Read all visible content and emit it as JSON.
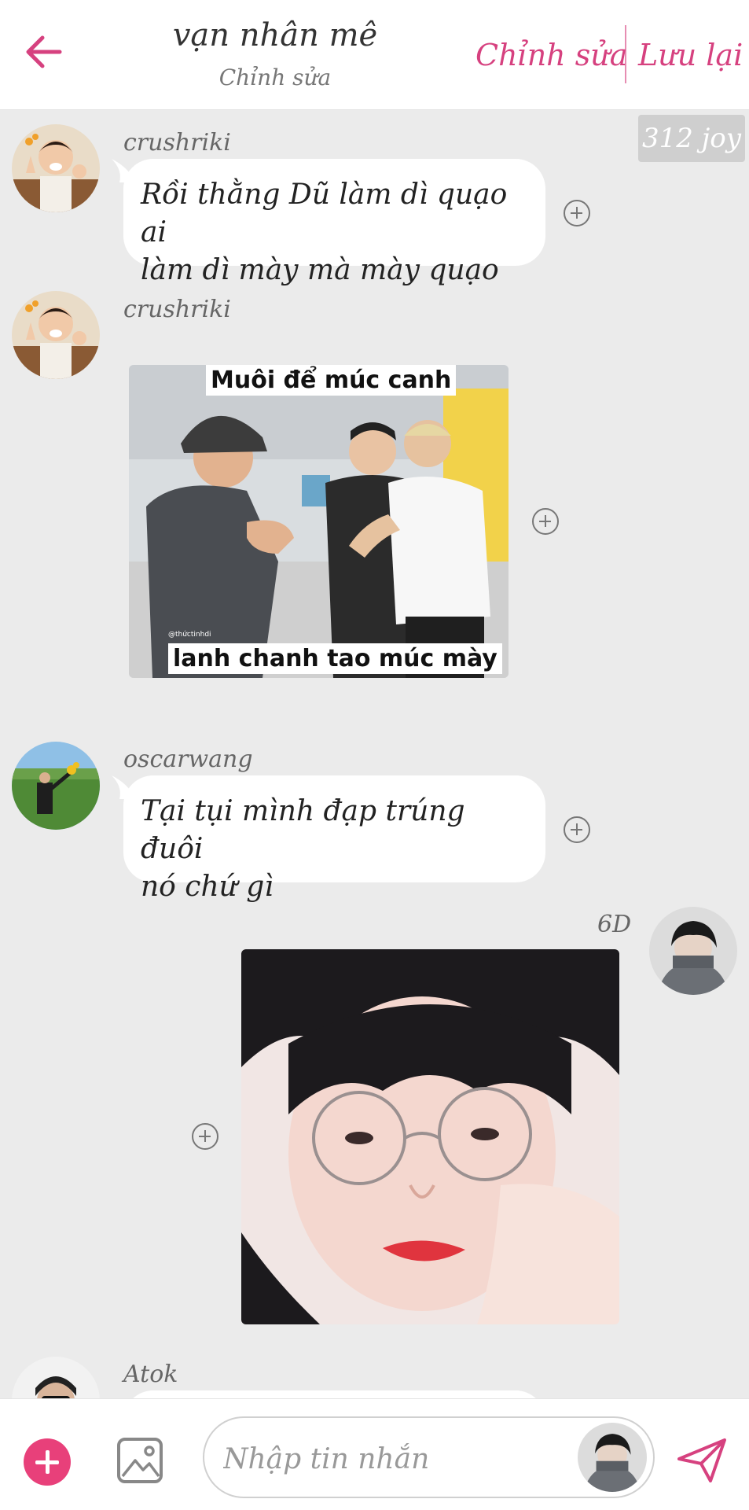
{
  "header": {
    "title": "vạn nhân mê",
    "subtitle": "Chỉnh sửa",
    "edit_label": "Chỉnh sửa",
    "save_label": "Lưu lại"
  },
  "tag_chip": "312 joy",
  "messages": [
    {
      "user": "crushriki",
      "type": "text",
      "text_line1": "Rồi thằng Dũ làm dì quạo ai",
      "text_line2": "làm dì mày mà mày quạo"
    },
    {
      "user": "crushriki",
      "type": "image",
      "caption_top": "Muôi để múc canh",
      "caption_bottom": "lanh chanh tao múc mày",
      "watermark": "@thứctinhdi"
    },
    {
      "user": "oscarwang",
      "type": "text",
      "text_line1": "Tại tụi mình đạp trúng đuôi",
      "text_line2": "nó chứ gì"
    },
    {
      "user": "6D",
      "type": "image"
    },
    {
      "user": "Atok",
      "type": "text"
    }
  ],
  "composer": {
    "placeholder": "Nhập tin nhắn"
  },
  "colors": {
    "accent": "#d6417f",
    "add_button": "#e8407a",
    "chat_background": "#ebebeb"
  }
}
